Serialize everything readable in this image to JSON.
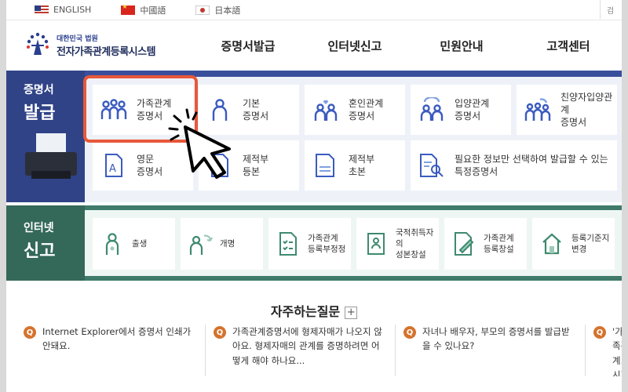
{
  "langbar": {
    "items": [
      {
        "label": "ENGLISH",
        "flag": "us-flag-icon"
      },
      {
        "label": "中國語",
        "flag": "cn-flag-icon"
      },
      {
        "label": "日本語",
        "flag": "jp-flag-icon"
      }
    ],
    "search_label": "검"
  },
  "header": {
    "org": "대한민국 법원",
    "title": "전자가족관계등록시스템",
    "nav": [
      "증명서발급",
      "인터넷신고",
      "민원안내",
      "고객센터"
    ]
  },
  "cert": {
    "label_line1": "증명서",
    "label_line2": "발급",
    "cards": [
      {
        "l1": "가족관계",
        "l2": "증명서",
        "icon": "family-icon"
      },
      {
        "l1": "기본",
        "l2": "증명서",
        "icon": "person-icon"
      },
      {
        "l1": "혼인관계",
        "l2": "증명서",
        "icon": "marriage-icon"
      },
      {
        "l1": "입양관계",
        "l2": "증명서",
        "icon": "adoption-icon"
      },
      {
        "l1": "친양자입양관계",
        "l2": "증명서",
        "icon": "full-adoption-icon"
      },
      {
        "l1": "영문",
        "l2": "증명서",
        "icon": "english-document-icon"
      },
      {
        "l1": "제적부",
        "l2": "등본",
        "icon": "register-icon"
      },
      {
        "l1": "제적부",
        "l2": "초본",
        "icon": "register-extract-icon"
      },
      {
        "l1": "필요한 정보만 선택하여 발급할 수 있는",
        "l2": "특정증명서",
        "icon": "search-document-icon"
      }
    ]
  },
  "report": {
    "label_line1": "인터넷",
    "label_line2": "신고",
    "cards": [
      {
        "l1": "출생",
        "l2": "",
        "icon": "birth-icon"
      },
      {
        "l1": "개명",
        "l2": "",
        "icon": "rename-icon"
      },
      {
        "l1": "가족관계",
        "l2": "등록부정정",
        "icon": "checklist-icon"
      },
      {
        "l1": "국적취득자의",
        "l2": "성본창설",
        "icon": "id-card-icon"
      },
      {
        "l1": "가족관계",
        "l2": "등록창설",
        "icon": "edit-document-icon"
      },
      {
        "l1": "등록기준지",
        "l2": "변경",
        "icon": "house-icon"
      }
    ]
  },
  "faq": {
    "title": "자주하는질문",
    "plus": "+",
    "items": [
      {
        "q": "Q",
        "text": "Internet Explorer에서 증명서 인쇄가 안돼요."
      },
      {
        "q": "Q",
        "text": "가족관계증명서에 형제자매가 나오지 않아요. 형제자매의 관계를 증명하려면 어떻게 해야 하나요..."
      },
      {
        "q": "Q",
        "text": "자녀나 배우자, 부모의 증명서를 발급받을 수 있나요?"
      },
      {
        "q": "Q",
        "text": "'가족관계... 시지가 되지 않"
      }
    ]
  },
  "colors": {
    "cert_bg": "#3a4f9c",
    "report_bg": "#3f7a6a",
    "highlight": "#e7583a",
    "cert_icon": "#3a5bbf",
    "report_icon": "#3f8a6f",
    "faq_badge": "#d5722c"
  }
}
